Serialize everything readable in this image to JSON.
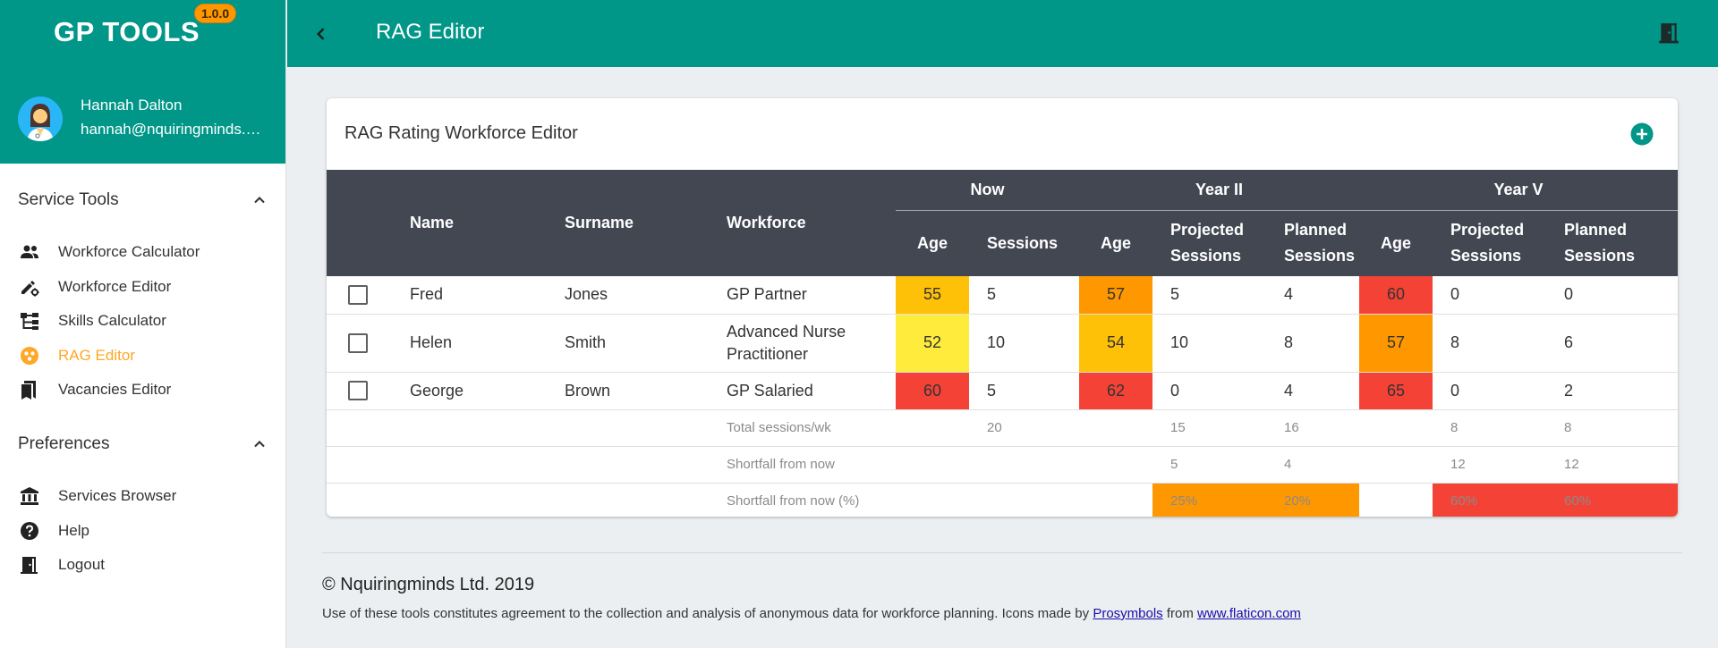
{
  "app": {
    "brand": "GP TOOLS",
    "version": "1.0.0"
  },
  "user": {
    "name": "Hannah Dalton",
    "email": "hannah@nquiringminds.com"
  },
  "sidebar": {
    "sections": [
      {
        "title": "Service Tools",
        "items": [
          {
            "label": "Workforce Calculator",
            "icon": "people-icon",
            "active": false
          },
          {
            "label": "Workforce Editor",
            "icon": "edit-settings-icon",
            "active": false
          },
          {
            "label": "Skills Calculator",
            "icon": "hierarchy-icon",
            "active": false
          },
          {
            "label": "RAG Editor",
            "icon": "rag-circles-icon",
            "active": true
          },
          {
            "label": "Vacancies Editor",
            "icon": "bookmarks-icon",
            "active": false
          }
        ]
      },
      {
        "title": "Preferences",
        "items": [
          {
            "label": "Services Browser",
            "icon": "bank-icon",
            "active": false
          },
          {
            "label": "Help",
            "icon": "help-icon",
            "active": false
          },
          {
            "label": "Logout",
            "icon": "door-exit-icon",
            "active": false
          }
        ]
      }
    ]
  },
  "header": {
    "title": "RAG Editor"
  },
  "card": {
    "title": "RAG Rating Workforce Editor"
  },
  "table": {
    "headers": {
      "name": "Name",
      "surname": "Surname",
      "workforce": "Workforce",
      "groups": [
        "Now",
        "Year II",
        "Year V"
      ],
      "age": "Age",
      "sessions": "Sessions",
      "projected_sessions": "Projected Sessions",
      "planned_sessions": "Planned Sessions"
    },
    "rows": [
      {
        "name": "Fred",
        "surname": "Jones",
        "workforce": "GP Partner",
        "now_age": "55",
        "now_sessions": "5",
        "y2_age": "57",
        "y2_projected": "5",
        "y2_planned": "4",
        "y5_age": "60",
        "y5_projected": "0",
        "y5_planned": "0"
      },
      {
        "name": "Helen",
        "surname": "Smith",
        "workforce": "Advanced Nurse Practitioner",
        "now_age": "52",
        "now_sessions": "10",
        "y2_age": "54",
        "y2_projected": "10",
        "y2_planned": "8",
        "y5_age": "57",
        "y5_projected": "8",
        "y5_planned": "6"
      },
      {
        "name": "George",
        "surname": "Brown",
        "workforce": "GP Salaried",
        "now_age": "60",
        "now_sessions": "5",
        "y2_age": "62",
        "y2_projected": "0",
        "y2_planned": "4",
        "y5_age": "65",
        "y5_projected": "0",
        "y5_planned": "2"
      }
    ],
    "summary": {
      "total_label": "Total sessions/wk",
      "total_now": "20",
      "total_y2_projected": "15",
      "total_y2_planned": "16",
      "total_y5_projected": "8",
      "total_y5_planned": "8",
      "shortfall_label": "Shortfall from now",
      "shortfall_y2_projected": "5",
      "shortfall_y2_planned": "4",
      "shortfall_y5_projected": "12",
      "shortfall_y5_planned": "12",
      "shortfall_pct_label": "Shortfall from now (%)",
      "shortfall_pct_y2_projected": "25%",
      "shortfall_pct_y2_planned": "20%",
      "shortfall_pct_y5_projected": "60%",
      "shortfall_pct_y5_planned": "60%"
    }
  },
  "rag_colors": {
    "red": "#f44336",
    "dark_orange": "#ff9800",
    "amber": "#ffc107",
    "yellow": "#ffeb3b"
  },
  "footer": {
    "copyright": "© Nquiringminds Ltd. 2019",
    "note_prefix": "Use of these tools constitutes agreement to the collection and analysis of anonymous data for workforce planning. Icons made by ",
    "link1": "Prosymbols",
    "note_middle": " from ",
    "link2": "www.flaticon.com"
  }
}
